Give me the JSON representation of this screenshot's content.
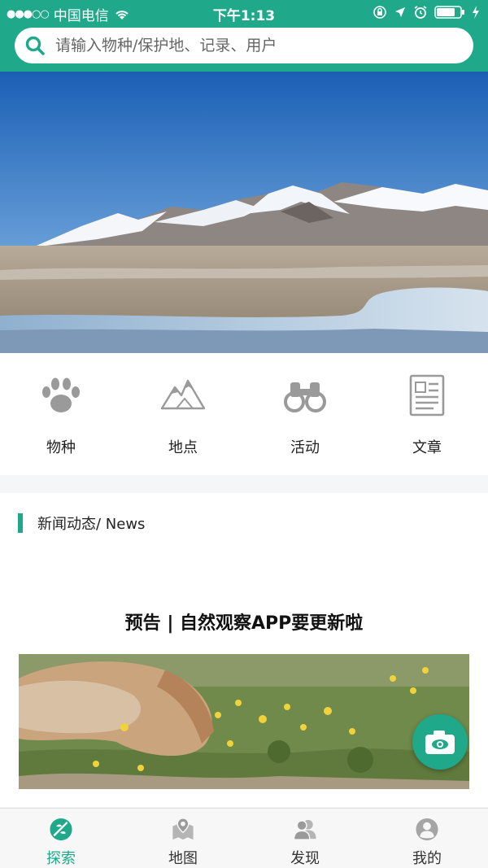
{
  "status_bar": {
    "signal": "●●●○○",
    "carrier": "中国电信",
    "time": "下午1:13",
    "icons": [
      "wifi-icon",
      "lock-rotation-icon",
      "location-icon",
      "alarm-icon",
      "battery-icon",
      "charging-icon"
    ]
  },
  "search": {
    "placeholder": "请输入物种/保护地、记录、用户",
    "icon": "search-icon"
  },
  "banner": {
    "description_icon": "mountain-landscape"
  },
  "categories": [
    {
      "label": "物种",
      "icon": "paw-icon"
    },
    {
      "label": "地点",
      "icon": "mountain-icon"
    },
    {
      "label": "活动",
      "icon": "binoculars-icon"
    },
    {
      "label": "文章",
      "icon": "document-icon"
    }
  ],
  "news": {
    "header": "新闻动态/ News",
    "article_title": "预告 | 自然观察APP要更新啦"
  },
  "camera_fab": {
    "icon": "camera-icon"
  },
  "tabs": [
    {
      "label": "探索",
      "icon": "explore-icon",
      "active": true
    },
    {
      "label": "地图",
      "icon": "map-icon",
      "active": false
    },
    {
      "label": "发现",
      "icon": "discover-icon",
      "active": false
    },
    {
      "label": "我的",
      "icon": "profile-icon",
      "active": false
    }
  ],
  "colors": {
    "accent": "#1fa88a",
    "icon_gray": "#9a9a9a",
    "text": "#222222"
  }
}
